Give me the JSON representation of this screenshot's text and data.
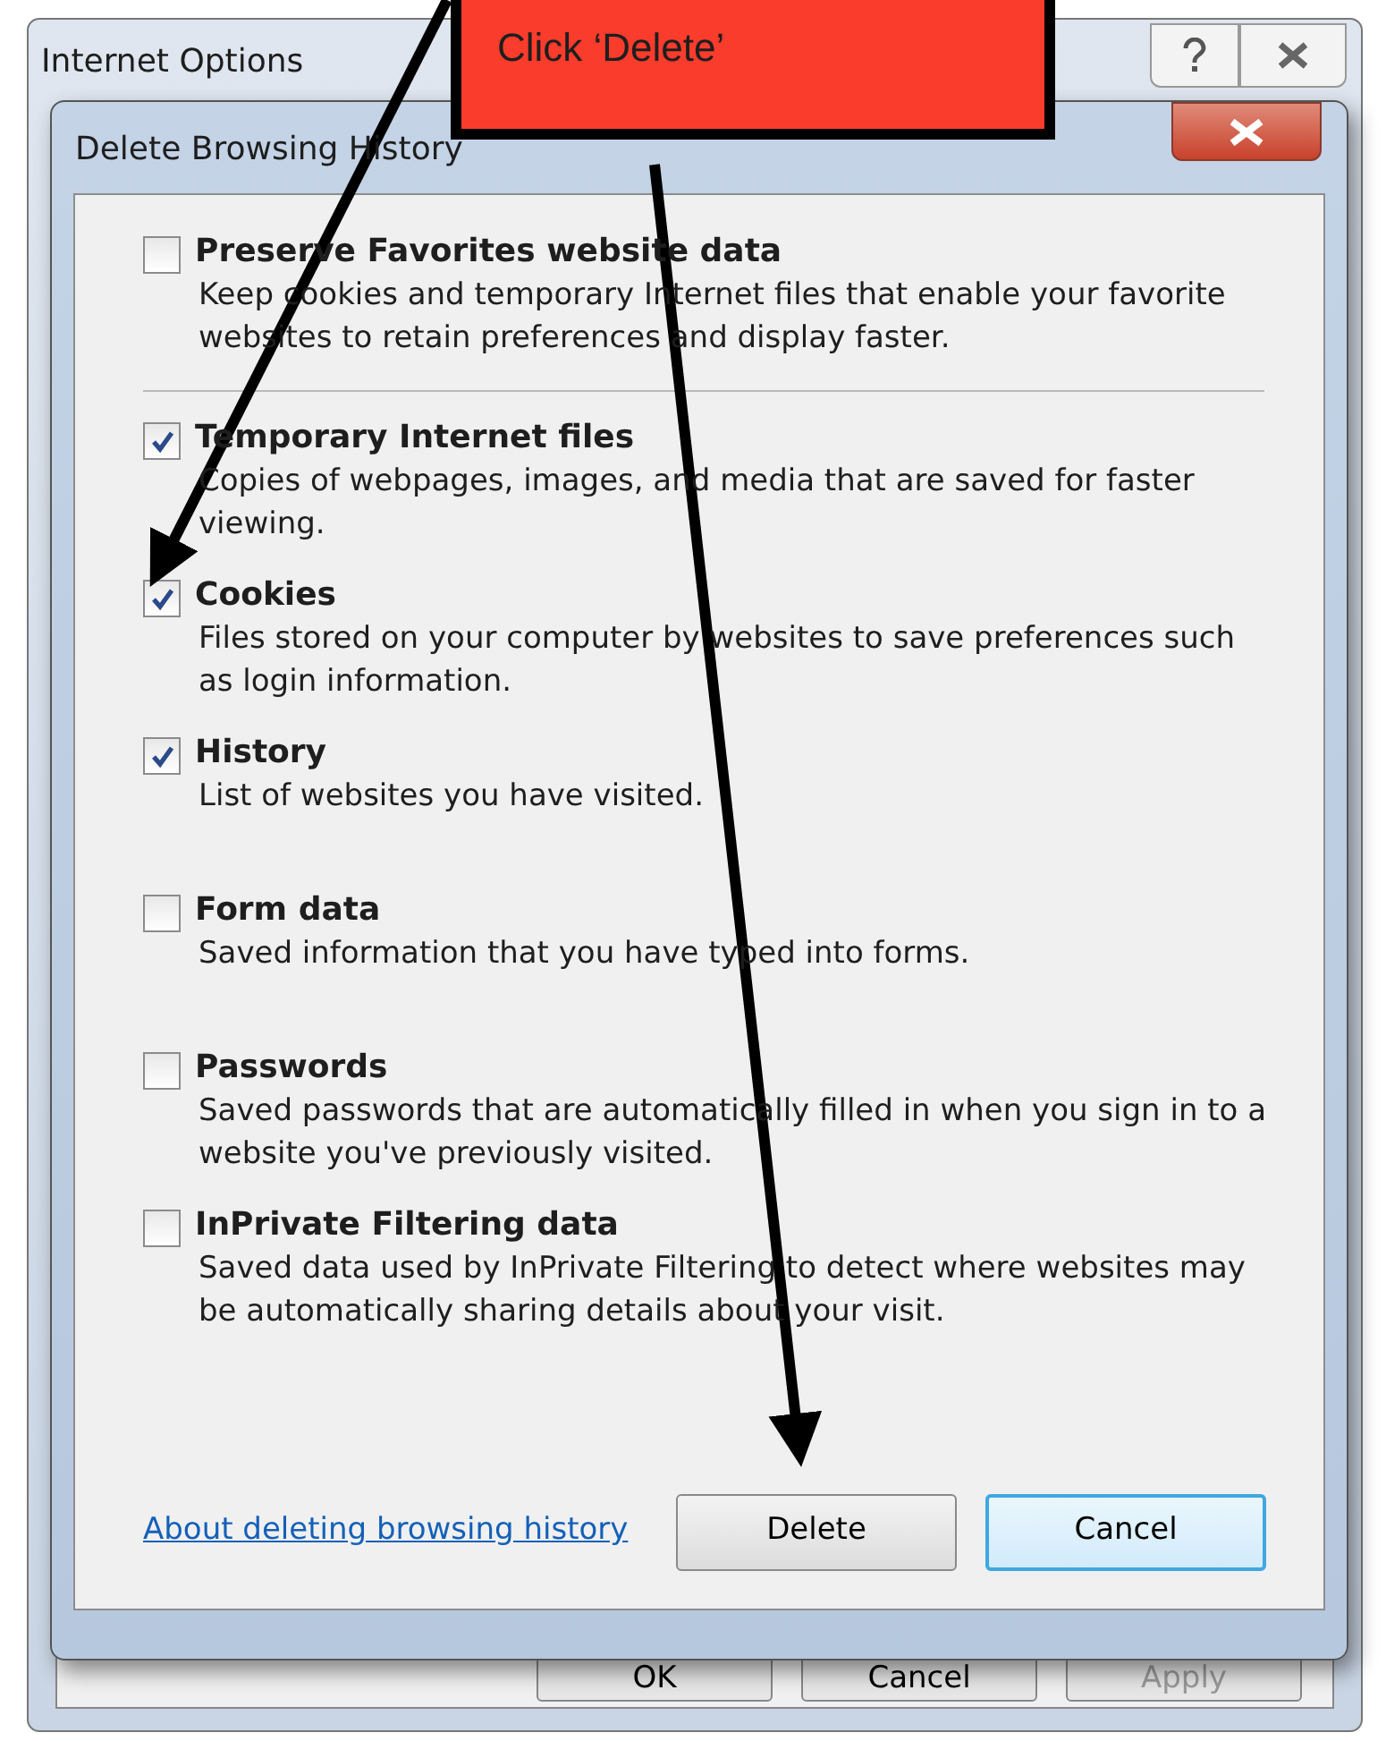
{
  "window": {
    "title": "Internet Options",
    "buttons": [
      {
        "label": "OK",
        "disabled": false
      },
      {
        "label": "Cancel",
        "disabled": false
      },
      {
        "label": "Apply",
        "disabled": true
      }
    ]
  },
  "dialog": {
    "title": "Delete Browsing History",
    "groups": [
      [
        {
          "title": "Preserve Favorites website data",
          "description": "Keep cookies and temporary Internet files that enable your favorite websites to retain preferences and display faster.",
          "checked": false
        }
      ],
      [
        {
          "title": "Temporary Internet files",
          "description": "Copies of webpages, images, and media that are saved for faster viewing.",
          "checked": true
        },
        {
          "title": "Cookies",
          "description": "Files stored on your computer by websites to save preferences such as login information.",
          "checked": true
        },
        {
          "title": "History",
          "description": "List of websites you have visited.",
          "checked": true
        },
        {
          "title": "Form data",
          "description": "Saved information that you have typed into forms.",
          "checked": false
        },
        {
          "title": "Passwords",
          "description": "Saved passwords that are automatically filled in when you sign in to a website you've previously visited.",
          "checked": false
        },
        {
          "title": "InPrivate Filtering data",
          "description": "Saved data used by InPrivate Filtering to detect where websites may be automatically sharing details about your visit.",
          "checked": false
        }
      ]
    ],
    "link": "About deleting browsing history",
    "buttons": [
      {
        "label": "Delete",
        "focused": false
      },
      {
        "label": "Cancel",
        "focused": true
      }
    ]
  },
  "annotation": {
    "text": "Click ‘Delete’"
  }
}
